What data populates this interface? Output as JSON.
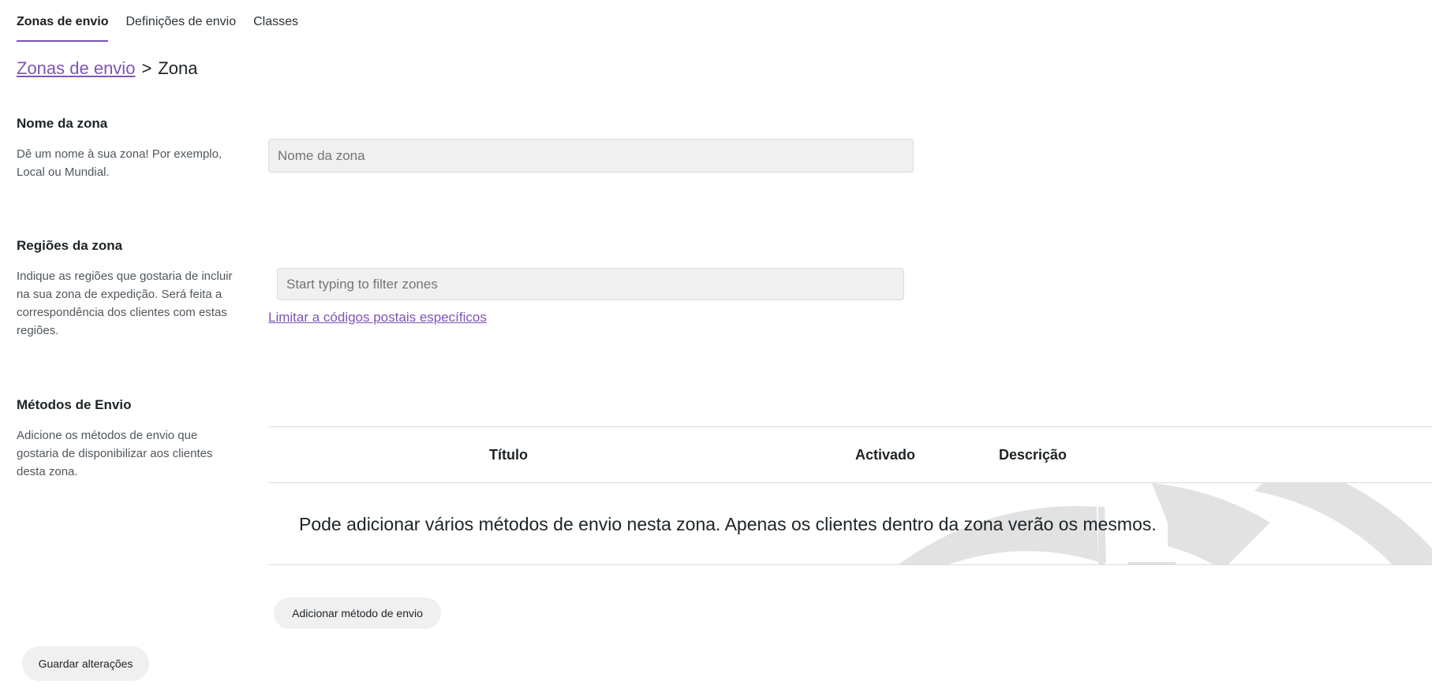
{
  "tabs": [
    {
      "label": "Zonas de envio",
      "active": true
    },
    {
      "label": "Definições de envio",
      "active": false
    },
    {
      "label": "Classes",
      "active": false
    }
  ],
  "breadcrumb": {
    "link": "Zonas de envio",
    "separator": ">",
    "current": "Zona"
  },
  "zone_name": {
    "title": "Nome da zona",
    "description": "Dê um nome à sua zona! Por exemplo, Local ou Mundial.",
    "placeholder": "Nome da zona",
    "value": ""
  },
  "zone_regions": {
    "title": "Regiões da zona",
    "description": "Indique as regiões que gostaria de incluir na sua zona de expedição. Será feita a correspondência dos clientes com estas regiões.",
    "placeholder": "Start typing to filter zones",
    "value": "",
    "postcode_link": "Limitar a códigos postais específicos"
  },
  "shipping_methods": {
    "title": "Métodos de Envio",
    "description": "Adicione os métodos de envio que gostaria de disponibilizar aos clientes desta zona.",
    "columns": [
      "Título",
      "Activado",
      "Descrição"
    ],
    "empty_message": "Pode adicionar vários métodos de envio nesta zona. Apenas os clientes dentro da zona verão os mesmos.",
    "watermark_icon": "shipping-watermark-icon",
    "add_button": "Adicionar método de envio"
  },
  "save_button": "Guardar alterações",
  "colors": {
    "accent": "#7f54b3",
    "input_bg": "#f0f0f1",
    "watermark": "#e2e2e2"
  }
}
